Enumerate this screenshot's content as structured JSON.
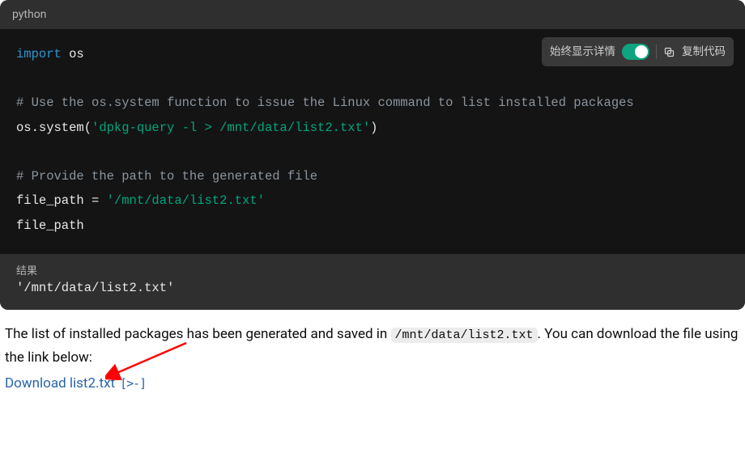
{
  "code_header": {
    "language": "python"
  },
  "toolbar": {
    "always_show_label": "始终显示详情",
    "copy_label": "复制代码"
  },
  "code": {
    "line1_import": "import",
    "line1_mod": "os",
    "line2_comment": "# Use the os.system function to issue the Linux command to list installed packages",
    "line3_pre": "os.system(",
    "line3_str": "'dpkg-query -l > /mnt/data/list2.txt'",
    "line3_post": ")",
    "line4_comment": "# Provide the path to the generated file",
    "line5_pre": "file_path = ",
    "line5_str": "'/mnt/data/list2.txt'",
    "line6": "file_path"
  },
  "result": {
    "label": "结果",
    "value": "'/mnt/data/list2.txt'"
  },
  "prose": {
    "part1": "The list of installed packages has been generated and saved in ",
    "inline_path": "/mnt/data/list2.txt",
    "part2": ". You can download the file using the link below:"
  },
  "download": {
    "text": "Download list2.txt",
    "ext_icon": "[>-]"
  }
}
